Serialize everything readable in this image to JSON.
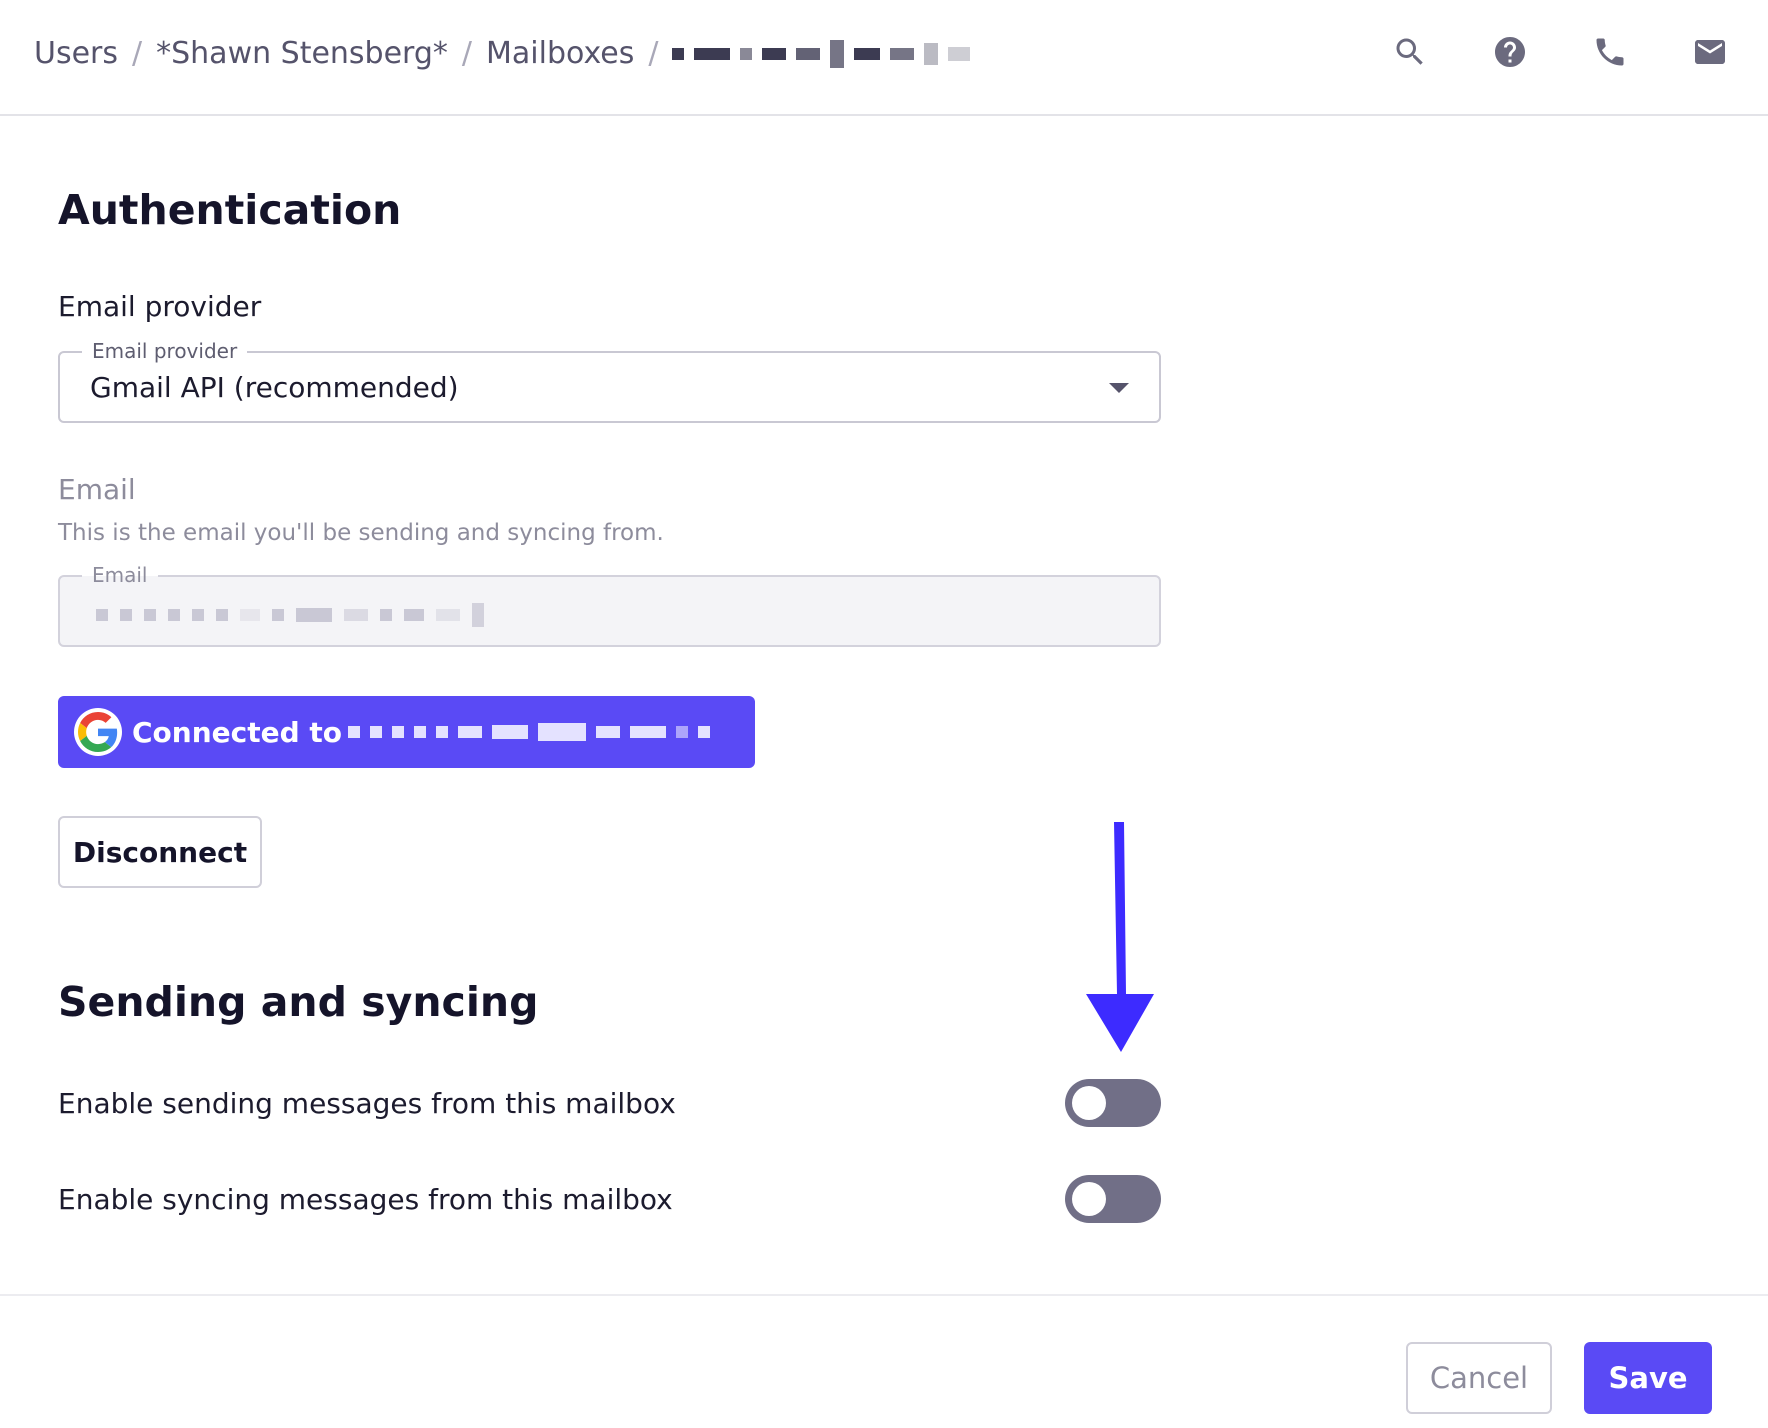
{
  "breadcrumb": {
    "items": [
      "Users",
      "*Shawn Stensberg*",
      "Mailboxes"
    ],
    "separator": "/",
    "current_redacted": true
  },
  "header_icons": [
    "search-icon",
    "help-icon",
    "phone-icon",
    "mail-icon"
  ],
  "authentication": {
    "title": "Authentication",
    "provider_label": "Email provider",
    "provider_field_legend": "Email provider",
    "provider_value": "Gmail API (recommended)",
    "email_label": "Email",
    "email_hint": "This is the email you'll be sending and syncing from.",
    "email_field_legend": "Email",
    "email_value_redacted": true,
    "connected_label": "Connected to",
    "disconnect_label": "Disconnect"
  },
  "sending_syncing": {
    "title": "Sending and syncing",
    "toggles": [
      {
        "label": "Enable sending messages from this mailbox",
        "enabled": false
      },
      {
        "label": "Enable syncing messages from this mailbox",
        "enabled": false
      }
    ]
  },
  "footer": {
    "cancel_label": "Cancel",
    "save_label": "Save"
  },
  "colors": {
    "accent": "#5a4af5",
    "toggle_off": "#716f87",
    "annotation_arrow": "#3d2bff"
  }
}
